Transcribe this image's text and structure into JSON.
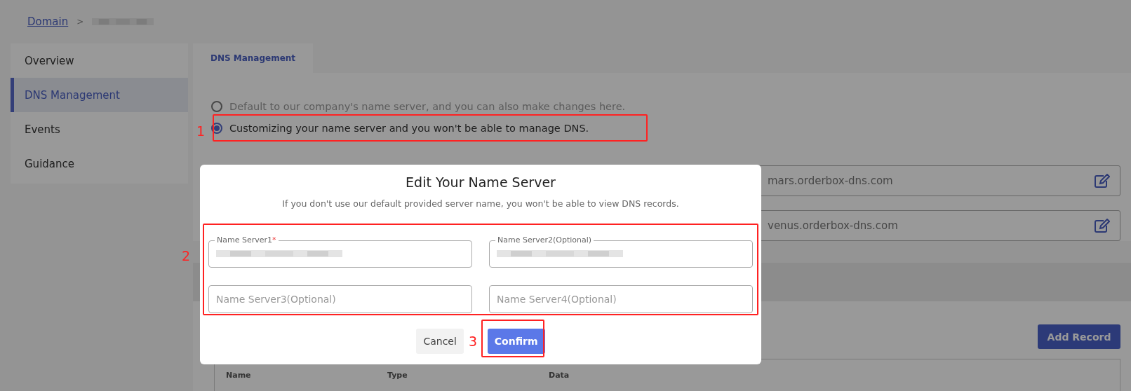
{
  "breadcrumb": {
    "separator": ">",
    "items": [
      {
        "kind": "link",
        "label": "Domain"
      },
      {
        "kind": "redacted"
      }
    ]
  },
  "sidebar": {
    "items": [
      {
        "label": "Overview",
        "selected": false
      },
      {
        "label": "DNS Management",
        "selected": true
      },
      {
        "label": "Events",
        "selected": false
      },
      {
        "label": "Guidance",
        "selected": false
      }
    ]
  },
  "tabs": [
    {
      "label": "DNS Management",
      "selected": true
    }
  ],
  "name_server_options": [
    {
      "label": "Default to our company's name server, and you can also make changes here.",
      "selected": false
    },
    {
      "label": "Customizing your name server and you won't be able to manage DNS.",
      "selected": true
    }
  ],
  "name_servers": [
    {
      "value": "mars.orderbox-dns.com"
    },
    {
      "value": "venus.orderbox-dns.com"
    }
  ],
  "add_record_button": "Add Record",
  "table": {
    "columns": [
      "Name",
      "Type",
      "Data"
    ]
  },
  "dialog": {
    "title": "Edit Your Name Server",
    "subtitle": "If you don't use our default provided server name, you won't be able to view DNS records.",
    "fields": [
      {
        "label": "Name Server1",
        "required_mark": "*",
        "redacted": true
      },
      {
        "label": "Name Server2(Optional)",
        "redacted": true
      },
      {
        "placeholder": "Name Server3(Optional)",
        "redacted": false
      },
      {
        "placeholder": "Name Server4(Optional)",
        "redacted": false
      }
    ],
    "buttons": [
      {
        "label": "Cancel",
        "kind": "secondary"
      },
      {
        "label": "Confirm",
        "kind": "primary"
      }
    ]
  },
  "annotations": [
    {
      "label": "1"
    },
    {
      "label": "2"
    },
    {
      "label": "3"
    }
  ]
}
